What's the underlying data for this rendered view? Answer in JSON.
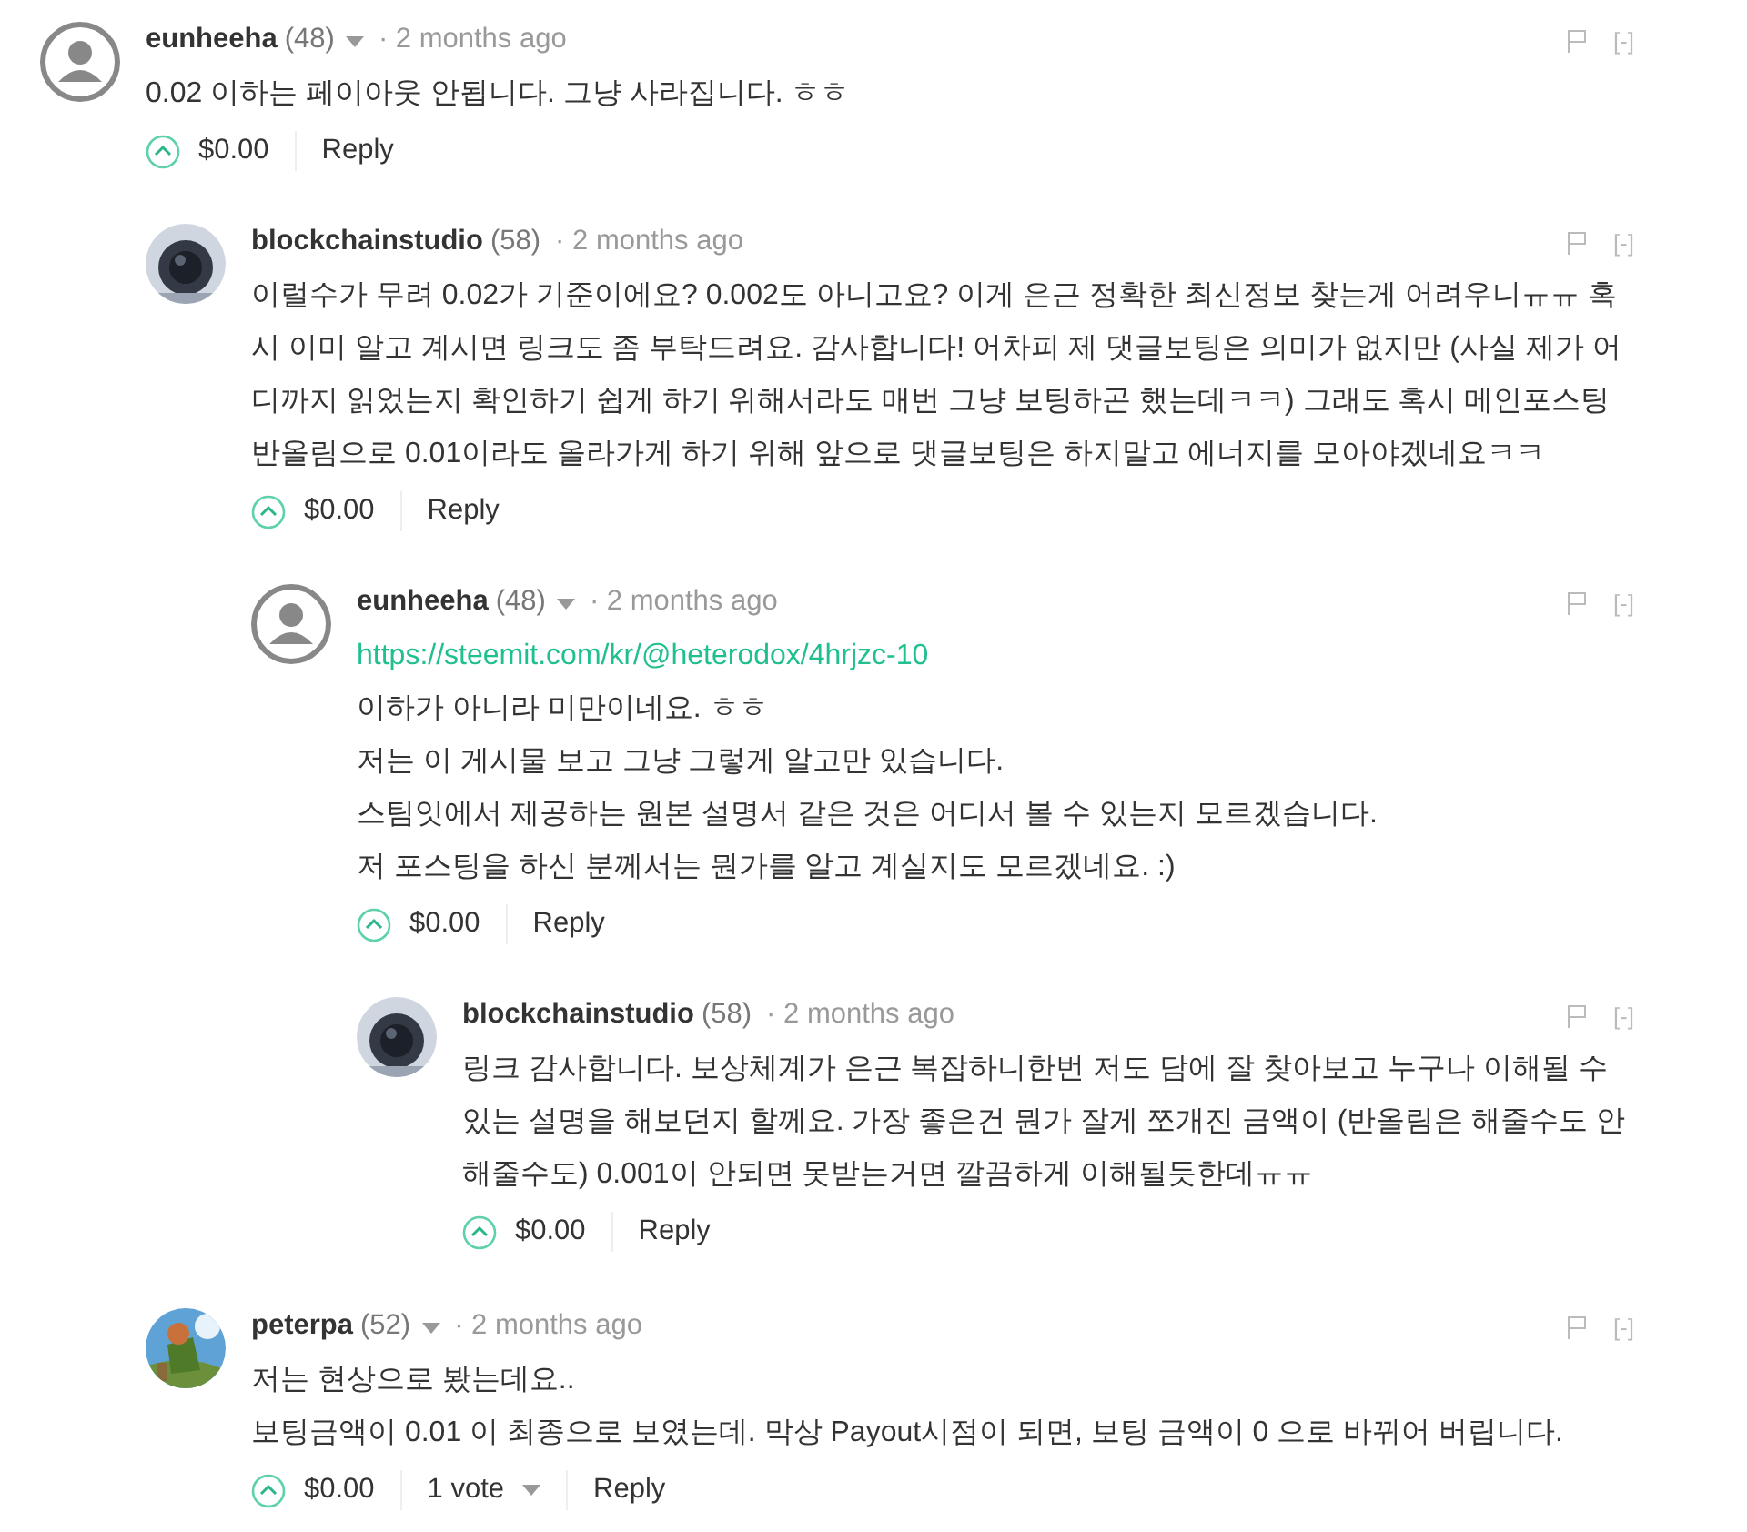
{
  "comments": [
    {
      "author": "eunheeha",
      "reputation": "(48)",
      "menu": true,
      "time": "· 2 months ago",
      "avatar": {
        "kind": "default"
      },
      "flag_toggle": "[-]",
      "body": [
        {
          "kind": "text",
          "text": "0.02 이하는 페이아웃 안됩니다. 그냥 사라집니다. ㅎㅎ"
        }
      ],
      "payout": "$0.00",
      "reply": "Reply",
      "children": [
        {
          "author": "blockchainstudio",
          "reputation": "(58)",
          "menu": false,
          "time": "· 2 months ago",
          "avatar": {
            "kind": "picture"
          },
          "flag_toggle": "[-]",
          "body": [
            {
              "kind": "text",
              "text": "이럴수가 무려 0.02가 기준이에요? 0.002도 아니고요? 이게 은근 정확한 최신정보 찾는게 어려우니ㅠㅠ 혹시 이미 알고 계시면 링크도 좀 부탁드려요. 감사합니다! 어차피 제 댓글보팅은 의미가 없지만 (사실 제가 어디까지 읽었는지 확인하기 쉽게 하기 위해서라도 매번 그냥 보팅하곤 했는데ㅋㅋ) 그래도 혹시 메인포스팅 반올림으로 0.01이라도 올라가게 하기 위해 앞으로 댓글보팅은 하지말고 에너지를 모아야겠네요ㅋㅋ"
            }
          ],
          "payout": "$0.00",
          "reply": "Reply",
          "children": [
            {
              "author": "eunheeha",
              "reputation": "(48)",
              "menu": true,
              "time": "· 2 months ago",
              "avatar": {
                "kind": "default"
              },
              "flag_toggle": "[-]",
              "body": [
                {
                  "kind": "link",
                  "text": "https://steemit.com/kr/@heterodox/4hrjzc-10"
                },
                {
                  "kind": "text",
                  "text": "이하가 아니라 미만이네요. ㅎㅎ"
                },
                {
                  "kind": "text",
                  "text": "저는 이 게시물 보고 그냥 그렇게 알고만 있습니다."
                },
                {
                  "kind": "text",
                  "text": "스팀잇에서 제공하는 원본 설명서 같은 것은 어디서 볼 수 있는지 모르겠습니다."
                },
                {
                  "kind": "text",
                  "text": "저 포스팅을 하신 분께서는 뭔가를 알고 계실지도 모르겠네요. :)"
                }
              ],
              "payout": "$0.00",
              "reply": "Reply",
              "children": [
                {
                  "author": "blockchainstudio",
                  "reputation": "(58)",
                  "menu": false,
                  "time": "· 2 months ago",
                  "avatar": {
                    "kind": "picture"
                  },
                  "flag_toggle": "[-]",
                  "body": [
                    {
                      "kind": "text",
                      "text": "링크 감사합니다. 보상체계가 은근 복잡하니한번 저도 담에 잘 찾아보고 누구나 이해될 수 있는 설명을 해보던지 할께요. 가장 좋은건 뭔가 잘게 쪼개진 금액이 (반올림은 해줄수도 안해줄수도) 0.001이 안되면 못받는거면 깔끔하게 이해될듯한데ㅠㅠ"
                    }
                  ],
                  "payout": "$0.00",
                  "reply": "Reply"
                }
              ]
            }
          ]
        },
        {
          "author": "peterpa",
          "reputation": "(52)",
          "menu": true,
          "time": "· 2 months ago",
          "avatar": {
            "kind": "picture"
          },
          "flag_toggle": "[-]",
          "body": [
            {
              "kind": "text",
              "text": "저는 현상으로 봤는데요.."
            },
            {
              "kind": "text",
              "text": "보팅금액이 0.01 이 최종으로 보였는데. 막상 Payout시점이 되면, 보팅 금액이 0 으로 바뀌어 버립니다."
            }
          ],
          "payout": "$0.00",
          "votes": "1 vote",
          "reply": "Reply"
        }
      ]
    }
  ]
}
